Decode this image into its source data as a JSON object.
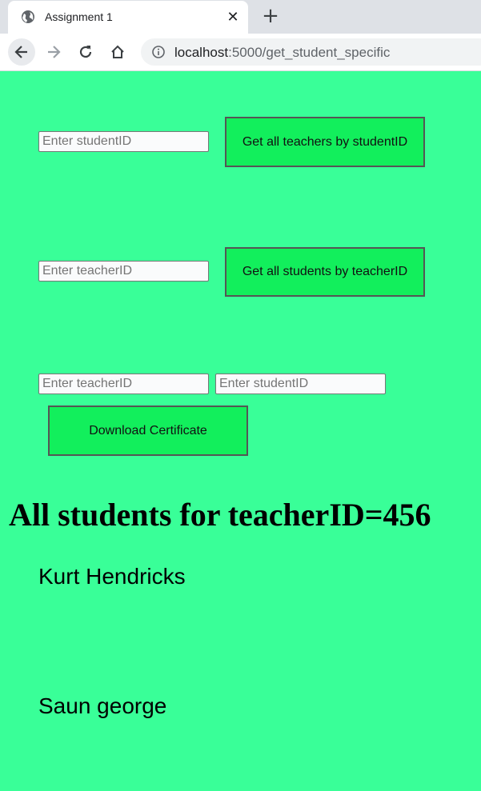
{
  "browser": {
    "tab_title": "Assignment 1",
    "url_host": "localhost",
    "url_path": ":5000/get_student_specific"
  },
  "form_teachers_by_student": {
    "student_placeholder": "Enter studentID",
    "button_label": "Get all teachers by studentID"
  },
  "form_students_by_teacher": {
    "teacher_placeholder": "Enter teacherID",
    "button_label": "Get all students by teacherID"
  },
  "form_certificate": {
    "teacher_placeholder": "Enter teacherID",
    "student_placeholder": "Enter studentID",
    "button_label": "Download Certificate"
  },
  "results": {
    "heading": "All students for teacherID=456",
    "students": [
      "Kurt Hendricks",
      "Saun george"
    ]
  },
  "colors": {
    "page_background": "#39ff98",
    "button_background": "#12ef5c"
  }
}
